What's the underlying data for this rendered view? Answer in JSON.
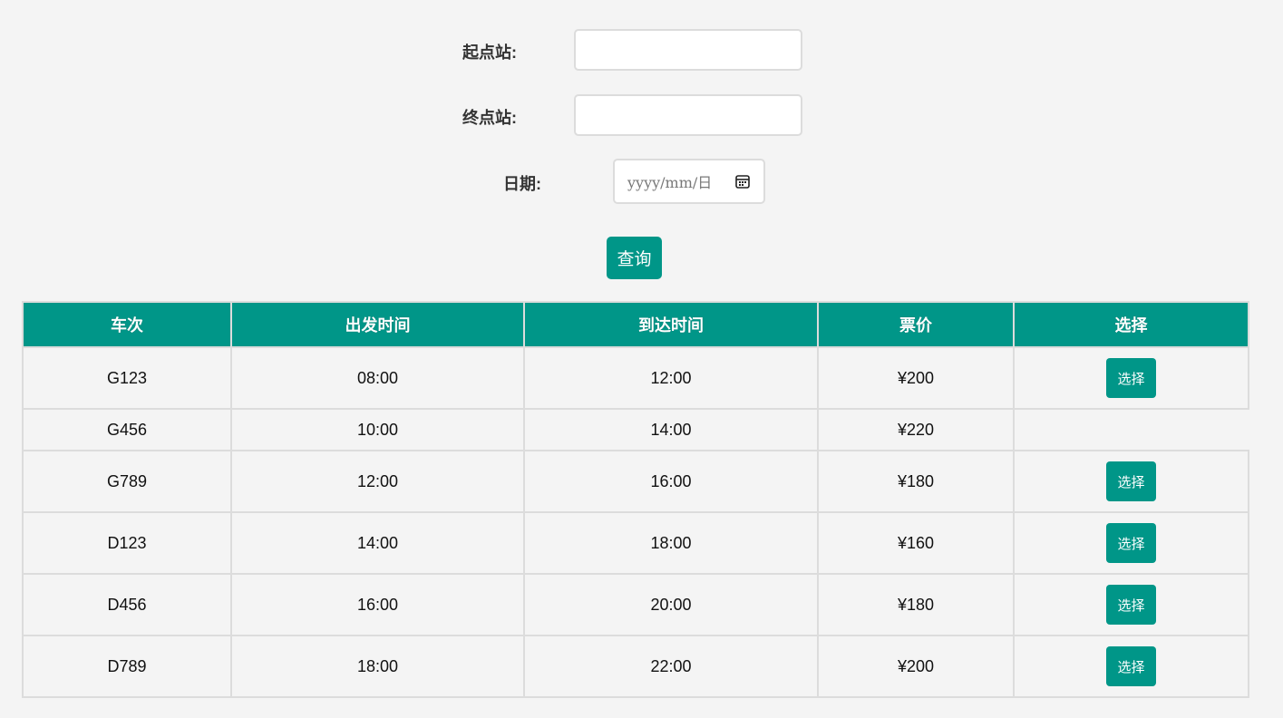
{
  "form": {
    "origin_label": "起点站:",
    "origin_value": "",
    "destination_label": "终点站:",
    "destination_value": "",
    "date_label": "日期:",
    "date_placeholder": "yyyy/mm/日",
    "query_label": "查询"
  },
  "table": {
    "headers": [
      "车次",
      "出发时间",
      "到达时间",
      "票价",
      "选择"
    ],
    "select_label": "选择",
    "rows": [
      {
        "train": "G123",
        "depart": "08:00",
        "arrive": "12:00",
        "price": "¥200",
        "has_select": true
      },
      {
        "train": "G456",
        "depart": "10:00",
        "arrive": "14:00",
        "price": "¥220",
        "has_select": false
      },
      {
        "train": "G789",
        "depart": "12:00",
        "arrive": "16:00",
        "price": "¥180",
        "has_select": true
      },
      {
        "train": "D123",
        "depart": "14:00",
        "arrive": "18:00",
        "price": "¥160",
        "has_select": true
      },
      {
        "train": "D456",
        "depart": "16:00",
        "arrive": "20:00",
        "price": "¥180",
        "has_select": true
      },
      {
        "train": "D789",
        "depart": "18:00",
        "arrive": "22:00",
        "price": "¥200",
        "has_select": true
      }
    ]
  },
  "colors": {
    "accent": "#009688",
    "background": "#f4f4f4",
    "border": "#dcdcdc"
  }
}
